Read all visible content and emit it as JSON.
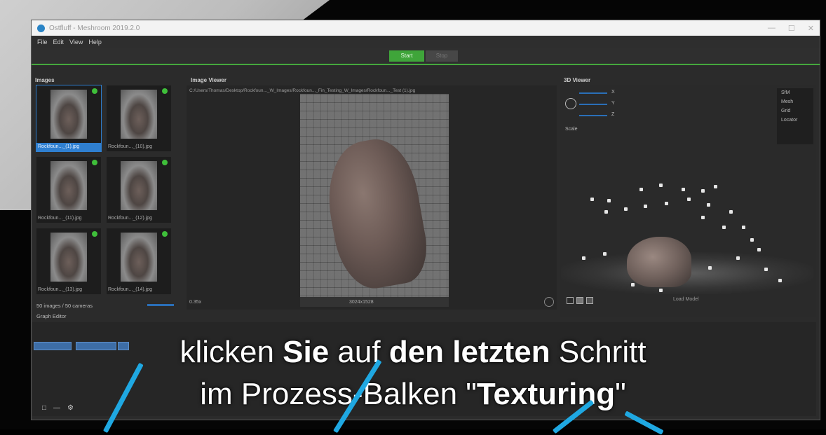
{
  "window": {
    "title": "Ostfluff - Meshroom 2019.2.0"
  },
  "menu": [
    "File",
    "Edit",
    "View",
    "Help"
  ],
  "toolbar": {
    "start_label": "Start",
    "stop_label": "Stop"
  },
  "images_panel": {
    "title": "Images",
    "thumbnails": [
      {
        "label": "Rockfoun..._(1).jpg",
        "selected": true
      },
      {
        "label": "Rockfoun..._(10).jpg",
        "selected": false
      },
      {
        "label": "Rockfoun..._(11).jpg",
        "selected": false
      },
      {
        "label": "Rockfoun..._(12).jpg",
        "selected": false
      },
      {
        "label": "Rockfoun..._(13).jpg",
        "selected": false
      },
      {
        "label": "Rockfoun..._(14).jpg",
        "selected": false
      }
    ],
    "count_text": "50 images / 50 cameras",
    "graph_editor_label": "Graph Editor"
  },
  "image_viewer": {
    "title": "Image Viewer",
    "path": "C:/Users/Thomas/Desktop/Rockfoun..._W_Images/Rockfoun..._Fin_Testing_W_Images/Rockfoun..._Test (1).jpg",
    "zoom": "0.35x",
    "resolution": "3024x1528"
  },
  "viewer_3d": {
    "title": "3D Viewer",
    "gizmo_rows": [
      "X",
      "Y",
      "Z"
    ],
    "scale_label": "Scale",
    "menu_items": [
      "SfM",
      "Mesh",
      "Grid",
      "Locator"
    ],
    "bottom_label": "Load Model"
  },
  "subtitle": {
    "line1_parts": [
      {
        "text": "klicken ",
        "bold": false
      },
      {
        "text": "Sie",
        "bold": true
      },
      {
        "text": " auf ",
        "bold": false
      },
      {
        "text": "den letzten",
        "bold": true
      },
      {
        "text": " Schritt",
        "bold": false
      }
    ],
    "line2_parts": [
      {
        "text": "im Prozess-Balken \"",
        "bold": false
      },
      {
        "text": "Texturing",
        "bold": true
      },
      {
        "text": "\"",
        "bold": false
      }
    ]
  },
  "colors": {
    "accent_green": "#3fa53a",
    "selection_blue": "#2f7fd0",
    "pointer_blue": "#1fa8e2"
  }
}
